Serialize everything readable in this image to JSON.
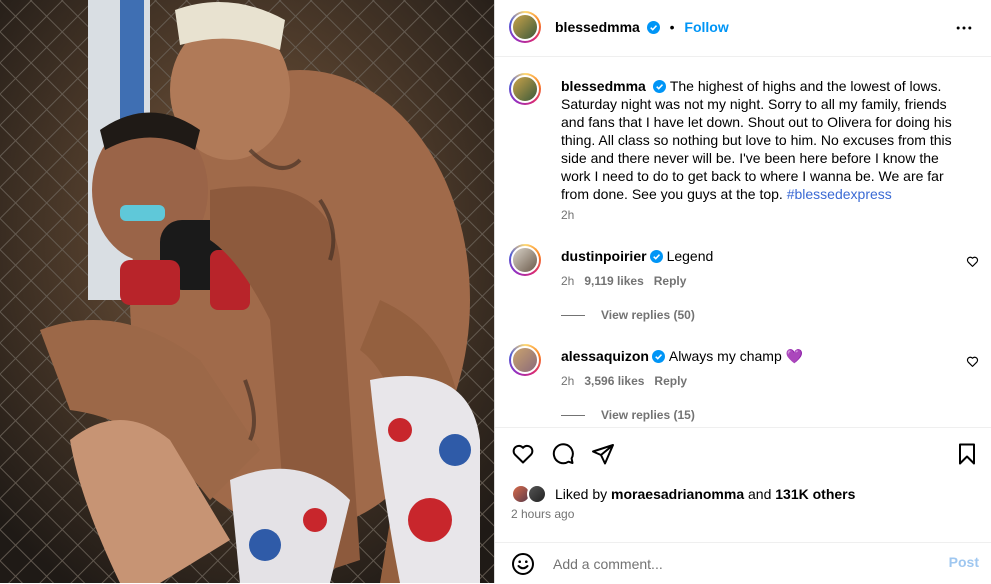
{
  "post": {
    "author": "blessedmma",
    "follow_label": "Follow",
    "separator": "•",
    "caption": "The highest of highs and the lowest of lows. Saturday night was not my night. Sorry to all my family, friends and fans that I have let down. Shout out to Olivera for doing his thing. All class so nothing but love to him. No excuses from this side and there never will be. I've been here before I know the work I need to do to get back to where I wanna be. We are far from done. See you guys at the top.",
    "hashtag": "#blessedexpress",
    "caption_time": "2h"
  },
  "comments": [
    {
      "user": "dustinpoirier",
      "text": "Legend",
      "time": "2h",
      "likes": "9,119 likes",
      "reply_label": "Reply",
      "view_replies": "View replies (50)"
    },
    {
      "user": "alessaquizon",
      "text": "Always my champ",
      "emoji": "💜",
      "time": "2h",
      "likes": "3,596 likes",
      "reply_label": "Reply",
      "view_replies": "View replies (15)"
    }
  ],
  "likes_summary": {
    "prefix": "Liked by",
    "user": "moraesadrianomma",
    "and": "and",
    "count": "131K others"
  },
  "timestamp": "2 hours ago",
  "add_comment": {
    "placeholder": "Add a comment...",
    "post_label": "Post"
  },
  "icons": [
    "verified-badge-icon",
    "more-options-icon",
    "heart-icon",
    "comment-icon",
    "share-icon",
    "bookmark-icon",
    "emoji-icon"
  ],
  "colors": {
    "accent": "#0095f6",
    "secondary_text": "#737373",
    "divider": "#efefef",
    "hashtag": "#3a6ad4"
  }
}
